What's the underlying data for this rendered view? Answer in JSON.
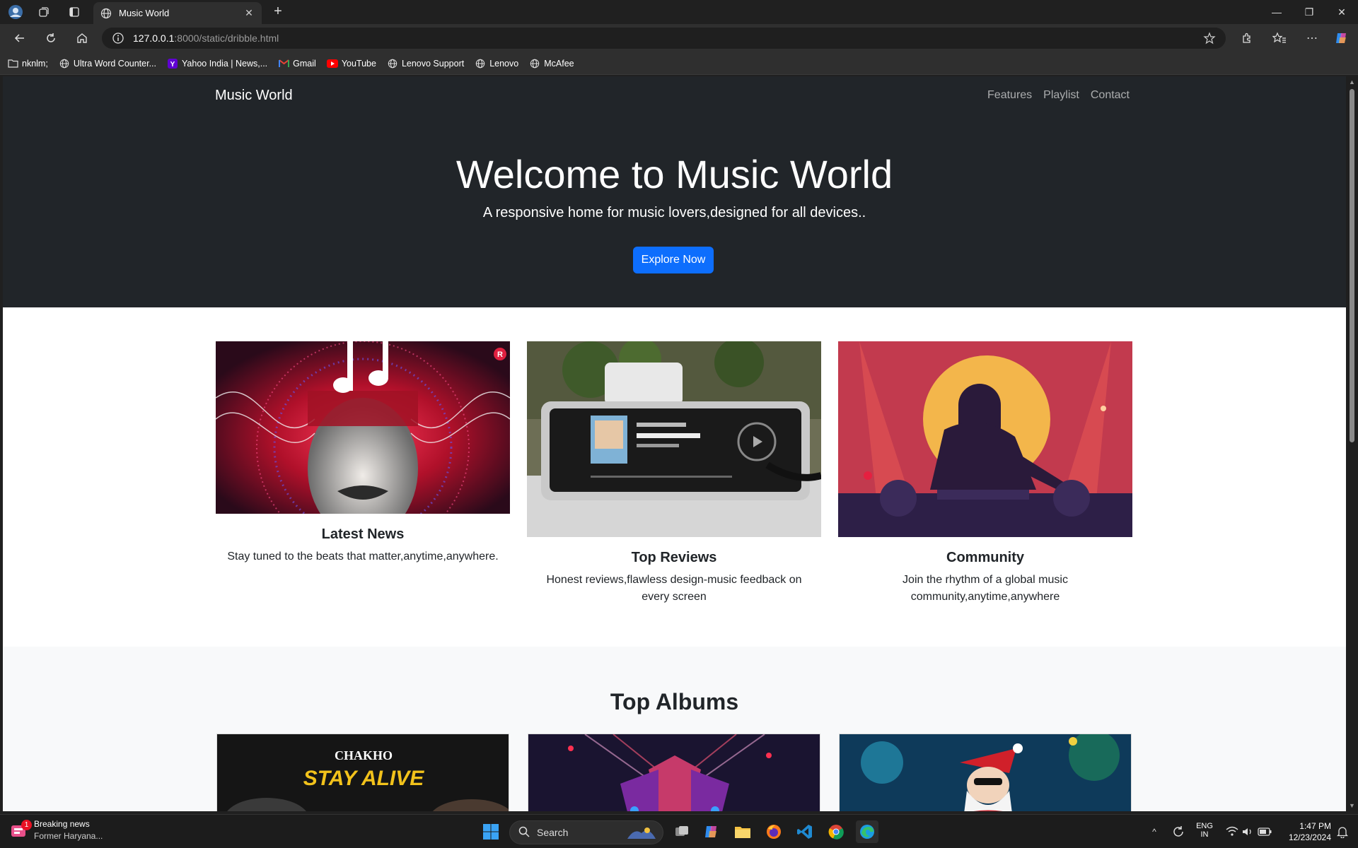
{
  "browser": {
    "tab_title": "Music World",
    "address_host": "127.0.0.1",
    "address_path": ":8000/static/dribble.html",
    "bookmarks": [
      {
        "label": "nknlm;",
        "icon": "folder-icon"
      },
      {
        "label": "Ultra Word Counter...",
        "icon": "globe-icon"
      },
      {
        "label": "Yahoo India | News,...",
        "icon": "yahoo-icon"
      },
      {
        "label": "Gmail",
        "icon": "gmail-icon"
      },
      {
        "label": "YouTube",
        "icon": "youtube-icon"
      },
      {
        "label": "Lenovo Support",
        "icon": "globe-icon"
      },
      {
        "label": "Lenovo",
        "icon": "globe-icon"
      },
      {
        "label": "McAfee",
        "icon": "globe-icon"
      }
    ]
  },
  "page": {
    "brand": "Music World",
    "nav": [
      "Features",
      "Playlist",
      "Contact"
    ],
    "hero_title": "Welcome to Music World",
    "hero_subtitle": "A responsive home for music lovers,designed for all devices..",
    "hero_button": "Explore Now",
    "features": [
      {
        "title": "Latest News",
        "text": "Stay tuned to the beats that matter,anytime,anywhere."
      },
      {
        "title": "Top Reviews",
        "text": "Honest reviews,flawless design-music feedback on every screen"
      },
      {
        "title": "Community",
        "text": "Join the rhythm of a global music community,anytime,anywhere"
      }
    ],
    "albums_title": "Top Albums",
    "album1_text": {
      "brand": "CHAKHO",
      "title": "STAY ALIVE"
    }
  },
  "taskbar": {
    "news_title": "Breaking news",
    "news_sub": "Former Haryana...",
    "news_badge": "1",
    "search_placeholder": "Search",
    "lang_top": "ENG",
    "lang_bottom": "IN",
    "time": "1:47 PM",
    "date": "12/23/2024"
  },
  "colors": {
    "hero_bg": "#212529",
    "primary_button": "#0d6efd",
    "albums_bg": "#f8f9fa"
  }
}
